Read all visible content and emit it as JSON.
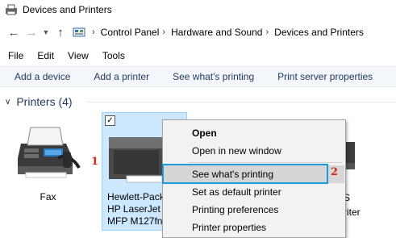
{
  "window": {
    "title": "Devices and Printers"
  },
  "navigation": {
    "breadcrumbs": [
      "Control Panel",
      "Hardware and Sound",
      "Devices and Printers"
    ]
  },
  "menubar": {
    "items": [
      "File",
      "Edit",
      "View",
      "Tools"
    ]
  },
  "command_bar": {
    "items": [
      "Add a device",
      "Add a printer",
      "See what's printing",
      "Print server properties"
    ]
  },
  "group": {
    "title": "Printers (4)"
  },
  "devices": {
    "fax": {
      "label": "Fax"
    },
    "hp": {
      "line1": "Hewlett-Pack",
      "line2": "HP LaserJet P",
      "line3": "MFP M127fn"
    },
    "right": {
      "line1": "S",
      "line2": "riter"
    }
  },
  "callouts": {
    "one": "1",
    "two": "2"
  },
  "context_menu": {
    "items": [
      "Open",
      "Open in new window",
      "See what's printing",
      "Set as default printer",
      "Printing preferences",
      "Printer properties"
    ],
    "highlighted": "See what's printing"
  },
  "colors": {
    "accent": "#1a9bd7",
    "selection": "#cce8ff",
    "callout": "#d9211b",
    "link": "#1e395b"
  }
}
